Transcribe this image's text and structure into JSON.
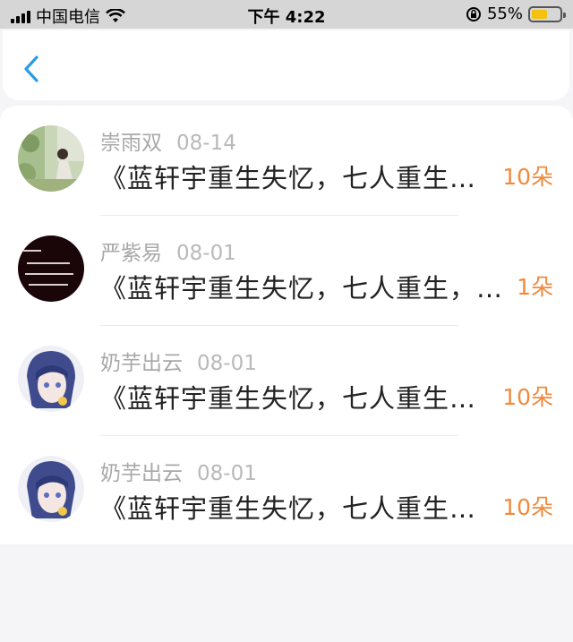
{
  "status_bar": {
    "carrier": "中国电信",
    "time": "下午 4:22",
    "battery_pct": "55%",
    "battery_level": 0.55,
    "icons": [
      "signal-icon",
      "wifi-icon",
      "rotation-lock-icon",
      "battery-icon"
    ]
  },
  "nav": {
    "back_icon": "chevron-left-icon",
    "accent": "#2a9be8"
  },
  "items": [
    {
      "user": "崇雨双",
      "date": "08-14",
      "title": "《蓝轩宇重生失忆，七人重生，苏醒后大闹三天",
      "flowers": "10朵"
    },
    {
      "user": "严紫易",
      "date": "08-01",
      "title": "《蓝轩宇重生失忆，七人重生，苏醒后大闹三天",
      "flowers": "1朵"
    },
    {
      "user": "奶芋出云",
      "date": "08-01",
      "title": "《蓝轩宇重生失忆，七人重生，苏醒后大闹三天",
      "flowers": "10朵"
    },
    {
      "user": "奶芋出云",
      "date": "08-01",
      "title": "《蓝轩宇重生失忆，七人重生，苏醒后大闹三天",
      "flowers": "10朵"
    }
  ],
  "colors": {
    "flowers": "#f08a3e",
    "username": "#a8a8a8",
    "title": "#222222"
  }
}
